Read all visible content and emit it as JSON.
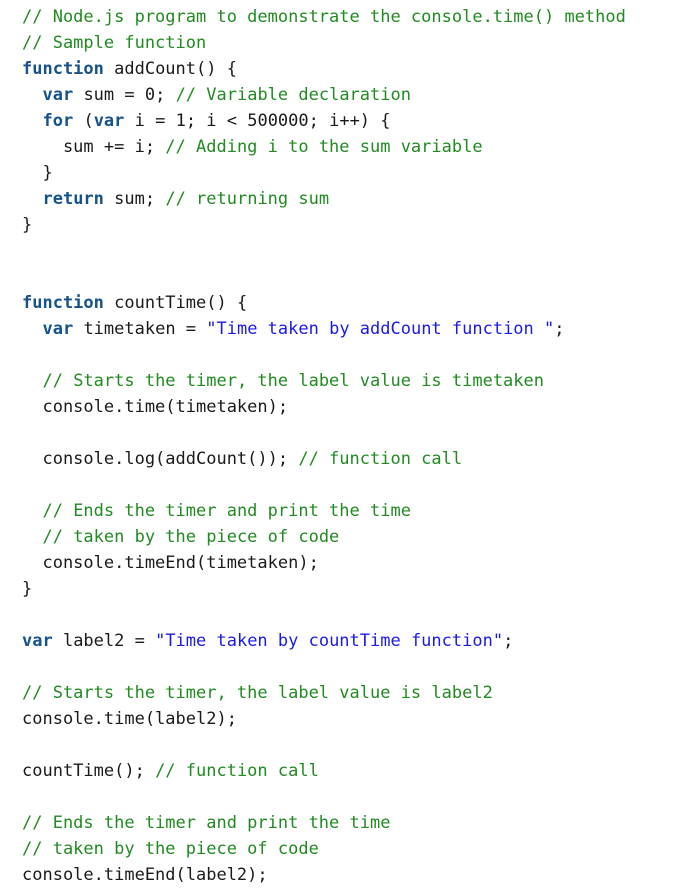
{
  "document": {
    "kind": "source-code-listing",
    "language": "javascript",
    "background_color": "#ffffff"
  },
  "theme": {
    "plain_color": "#1a1a1a",
    "comment_color": "#218a21",
    "keyword_color": "#16528c",
    "string_color": "#1a1aee"
  },
  "code": {
    "lines": [
      {
        "tokens": [
          {
            "t": "comment",
            "s": "// Node.js program to demonstrate the console.time() method"
          }
        ]
      },
      {
        "tokens": [
          {
            "t": "comment",
            "s": "// Sample function"
          }
        ]
      },
      {
        "tokens": [
          {
            "t": "keyword",
            "s": "function"
          },
          {
            "t": "plain",
            "s": " addCount() {"
          }
        ]
      },
      {
        "tokens": [
          {
            "t": "plain",
            "s": "  "
          },
          {
            "t": "keyword",
            "s": "var"
          },
          {
            "t": "plain",
            "s": " sum = 0; "
          },
          {
            "t": "comment",
            "s": "// Variable declaration"
          }
        ]
      },
      {
        "tokens": [
          {
            "t": "plain",
            "s": "  "
          },
          {
            "t": "keyword",
            "s": "for"
          },
          {
            "t": "plain",
            "s": " ("
          },
          {
            "t": "keyword",
            "s": "var"
          },
          {
            "t": "plain",
            "s": " i = 1; i < 500000; i++) {"
          }
        ]
      },
      {
        "tokens": [
          {
            "t": "plain",
            "s": "    sum += i; "
          },
          {
            "t": "comment",
            "s": "// Adding i to the sum variable"
          }
        ]
      },
      {
        "tokens": [
          {
            "t": "plain",
            "s": "  }"
          }
        ]
      },
      {
        "tokens": [
          {
            "t": "plain",
            "s": "  "
          },
          {
            "t": "keyword",
            "s": "return"
          },
          {
            "t": "plain",
            "s": " sum; "
          },
          {
            "t": "comment",
            "s": "// returning sum"
          }
        ]
      },
      {
        "tokens": [
          {
            "t": "plain",
            "s": "}"
          }
        ]
      },
      {
        "tokens": []
      },
      {
        "tokens": []
      },
      {
        "tokens": [
          {
            "t": "keyword",
            "s": "function"
          },
          {
            "t": "plain",
            "s": " countTime() {"
          }
        ]
      },
      {
        "tokens": [
          {
            "t": "plain",
            "s": "  "
          },
          {
            "t": "keyword",
            "s": "var"
          },
          {
            "t": "plain",
            "s": " timetaken = "
          },
          {
            "t": "string",
            "s": "\"Time taken by addCount function \""
          },
          {
            "t": "plain",
            "s": ";"
          }
        ]
      },
      {
        "tokens": []
      },
      {
        "tokens": [
          {
            "t": "plain",
            "s": "  "
          },
          {
            "t": "comment",
            "s": "// Starts the timer, the label value is timetaken"
          }
        ]
      },
      {
        "tokens": [
          {
            "t": "plain",
            "s": "  console.time(timetaken);"
          }
        ]
      },
      {
        "tokens": []
      },
      {
        "tokens": [
          {
            "t": "plain",
            "s": "  console.log(addCount()); "
          },
          {
            "t": "comment",
            "s": "// function call"
          }
        ]
      },
      {
        "tokens": []
      },
      {
        "tokens": [
          {
            "t": "plain",
            "s": "  "
          },
          {
            "t": "comment",
            "s": "// Ends the timer and print the time"
          }
        ]
      },
      {
        "tokens": [
          {
            "t": "plain",
            "s": "  "
          },
          {
            "t": "comment",
            "s": "// taken by the piece of code"
          }
        ]
      },
      {
        "tokens": [
          {
            "t": "plain",
            "s": "  console.timeEnd(timetaken);"
          }
        ]
      },
      {
        "tokens": [
          {
            "t": "plain",
            "s": "}"
          }
        ]
      },
      {
        "tokens": []
      },
      {
        "tokens": [
          {
            "t": "keyword",
            "s": "var"
          },
          {
            "t": "plain",
            "s": " label2 = "
          },
          {
            "t": "string",
            "s": "\"Time taken by countTime function\""
          },
          {
            "t": "plain",
            "s": ";"
          }
        ]
      },
      {
        "tokens": []
      },
      {
        "tokens": [
          {
            "t": "comment",
            "s": "// Starts the timer, the label value is label2"
          }
        ]
      },
      {
        "tokens": [
          {
            "t": "plain",
            "s": "console.time(label2);"
          }
        ]
      },
      {
        "tokens": []
      },
      {
        "tokens": [
          {
            "t": "plain",
            "s": "countTime(); "
          },
          {
            "t": "comment",
            "s": "// function call"
          }
        ]
      },
      {
        "tokens": []
      },
      {
        "tokens": [
          {
            "t": "comment",
            "s": "// Ends the timer and print the time"
          }
        ]
      },
      {
        "tokens": [
          {
            "t": "comment",
            "s": "// taken by the piece of code"
          }
        ]
      },
      {
        "tokens": [
          {
            "t": "plain",
            "s": "console.timeEnd(label2);"
          }
        ]
      }
    ]
  }
}
